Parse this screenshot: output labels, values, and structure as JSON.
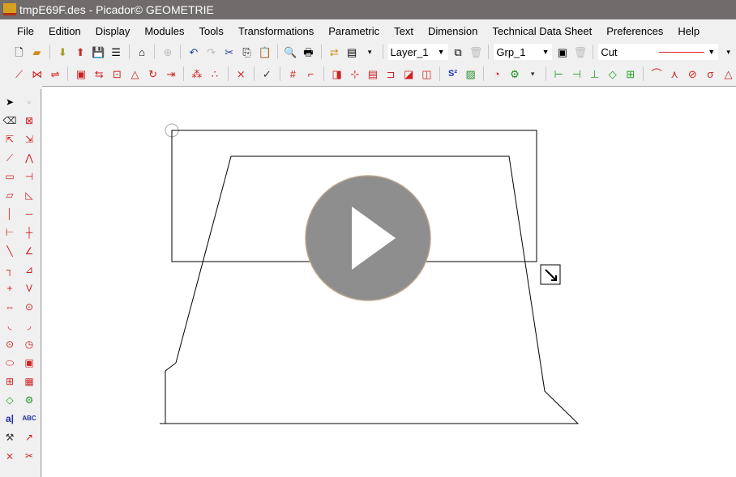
{
  "window": {
    "title": "tmpE69F.des - Picador© GEOMETRIE"
  },
  "menu": [
    "File",
    "Edition",
    "Display",
    "Modules",
    "Tools",
    "Transformations",
    "Parametric",
    "Text",
    "Dimension",
    "Technical Data Sheet",
    "Preferences",
    "Help"
  ],
  "toolbar": {
    "layer": "Layer_1",
    "group": "Grp_1",
    "line_type": "Cut",
    "line_color": "#e02020"
  },
  "player": {
    "icon": "play-icon",
    "color": "#8e8e8e"
  }
}
